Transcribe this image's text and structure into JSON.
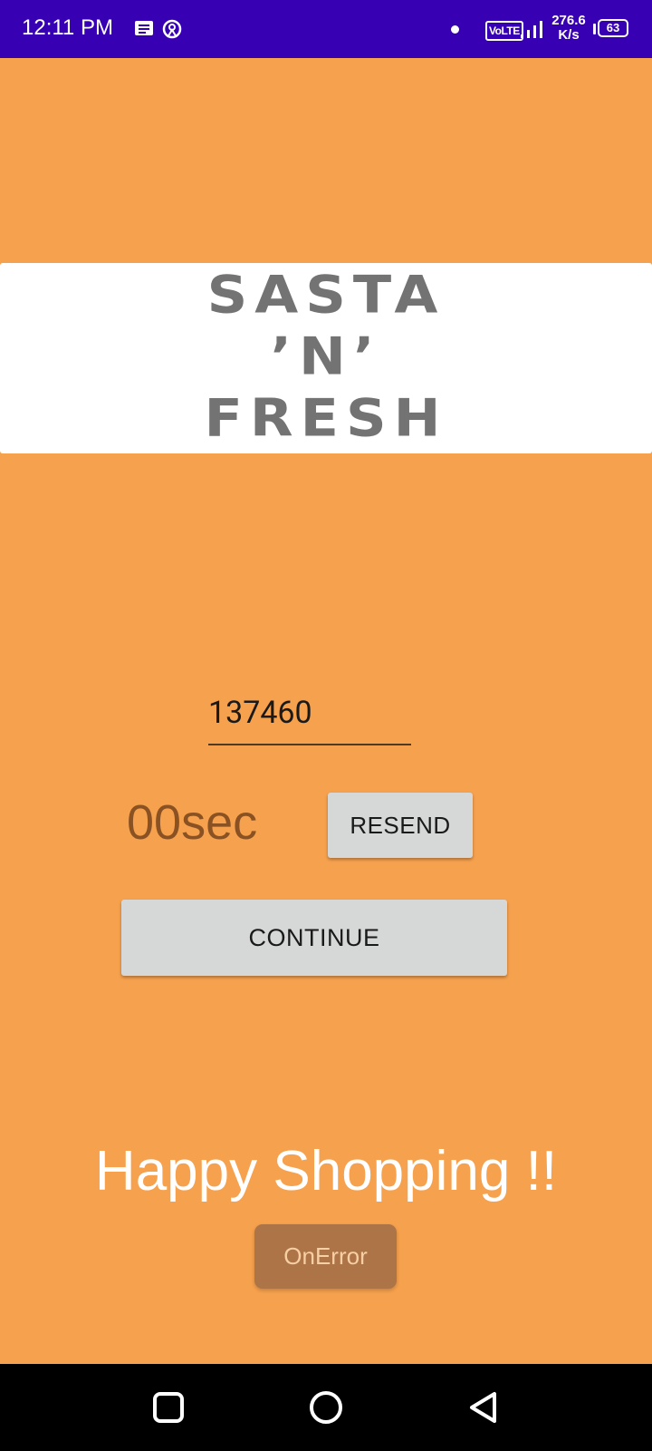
{
  "status_bar": {
    "time": "12:11 PM",
    "notification_icon": "message-notification-icon",
    "hotspot_icon": "hotspot-icon",
    "volte": "VoLTE",
    "signal_icon": "signal-icon",
    "speed_value": "276.6",
    "speed_unit": "K/s",
    "battery": "63"
  },
  "logo": {
    "line1": "SASTA",
    "line2": "’N’",
    "line3": "FRESH"
  },
  "otp": {
    "value": "137460"
  },
  "timer": {
    "text": "00sec"
  },
  "buttons": {
    "resend": "RESEND",
    "continue": "CONTINUE",
    "onerror": "OnError"
  },
  "footer": {
    "happy_text": "Happy Shopping !!"
  },
  "nav_bar": {
    "recents_icon": "recents-square-icon",
    "home_icon": "home-circle-icon",
    "back_icon": "back-triangle-icon"
  },
  "colors": {
    "background": "#f6a14d",
    "status_bar": "#3700b3",
    "button_grey": "#d6d7d7",
    "onerror_button": "#ac7447",
    "timer_text": "#8a5223",
    "logo_text": "#737373"
  }
}
